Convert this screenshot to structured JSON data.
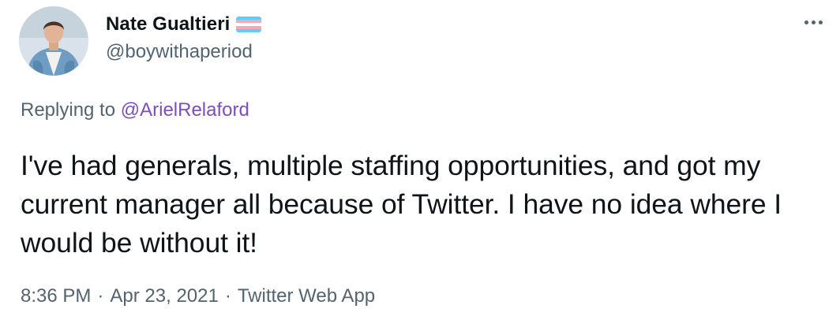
{
  "author": {
    "display_name": "Nate Gualtieri",
    "handle": "@boywithaperiod",
    "flag_colors": [
      "#5BCEFA",
      "#F5A9B8",
      "#FFFFFF",
      "#F5A9B8",
      "#5BCEFA"
    ]
  },
  "more_icon": "more-horizontal-icon",
  "reply": {
    "prefix": "Replying to",
    "mention": "@ArielRelaford"
  },
  "tweet_text": "I've had generals, multiple staffing opportunities, and got my current manager all because of Twitter. I have no idea where I would be without it!",
  "meta": {
    "time": "8:36 PM",
    "separator": "·",
    "date": "Apr 23, 2021",
    "source": "Twitter Web App"
  },
  "colors": {
    "text": "#0f1419",
    "secondary": "#536471",
    "link": "#7d4dbd"
  }
}
